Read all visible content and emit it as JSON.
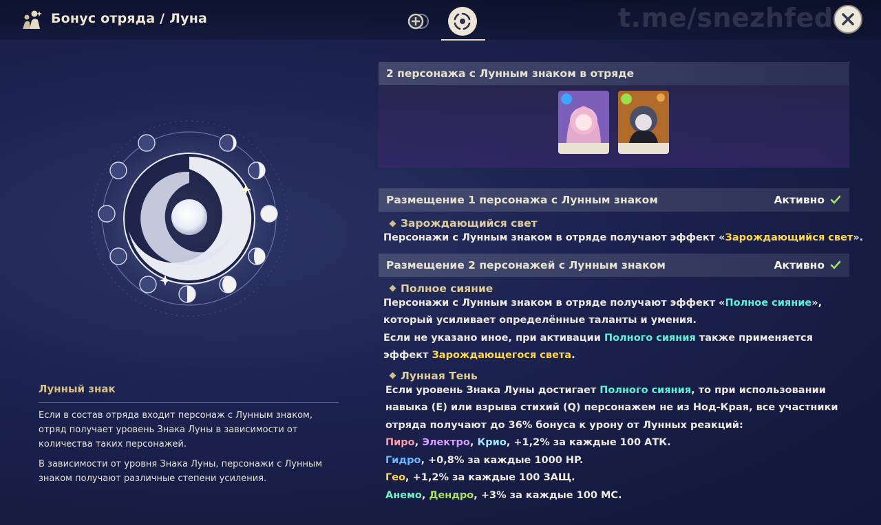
{
  "header": {
    "title": "Бонус отряда / Луна",
    "watermark": "t.me/snezhfed",
    "icons": [
      "party-icon",
      "elemental-resonance-tab-icon",
      "moon-tab-icon",
      "close-icon"
    ]
  },
  "lore": {
    "title": "Лунный знак",
    "p1": "Если в состав отряда входит персонаж с Лунным знаком, отряд получает уровень Знака Луны в зависимости от количества таких персонажей.",
    "p2": "В зависимости от уровня Знака Луны, персонажи с Лунным знаком получают различные степени усиления."
  },
  "sections": {
    "party": {
      "title": "2 персонажа с Лунным знаком в отряде"
    },
    "s1": {
      "title": "Размещение 1 персонажа с Лунным знаком",
      "status": "Активно",
      "sub": "Зарождающийся свет",
      "d1a": "Персонажи с Лунным знаком в отряде получают эффект «",
      "d1b": "Зарождающийся свет",
      "d1c": "»."
    },
    "s2": {
      "title": "Размещение 2 персонажей с Лунным знаком",
      "status": "Активно",
      "sub1": "Полное сияние",
      "l1a": "Персонажи с Лунным знаком в отряде получают эффект «",
      "l1b": "Полное сияние",
      "l1c": "»,",
      "l2": "который усиливает определённые таланты и умения.",
      "l3a": "Если не указано иное, при активации ",
      "l3b": "Полного сияния",
      "l3c": " также применяется",
      "l4a": "эффект ",
      "l4b": "Зарождающегося света",
      "l4c": ".",
      "sub2": "Лунная Тень",
      "m1a": "Если уровень Знака Луны достигает ",
      "m1b": "Полного сияния",
      "m1c": ", то при использовании",
      "m2": "навыка (E) или взрыва стихий (Q) персонажем не из Нод-Края, все участники",
      "m3": "отряда получают до 36% бонуса к урону от Лунных реакций:",
      "pyro": "Пиро",
      "electro": "Электро",
      "cryo": "Крио",
      "atk": ", +1,2% за каждые 100 АТК.",
      "hydro": "Гидро",
      "hp": ", +0,8% за каждые 1000 HP.",
      "geo": "Гео",
      "def": ", +1,2% за каждые 100 ЗАЩ.",
      "anemo": "Анемо",
      "dendro": "Дендро",
      "em": ",  +3% за каждые 100 МС."
    }
  },
  "colors": {
    "accent_gold": "#d6c08a",
    "highlight_yellow": "#ffd84a",
    "highlight_cyan": "#5ef0d6",
    "active_check": "#a6e36a"
  }
}
